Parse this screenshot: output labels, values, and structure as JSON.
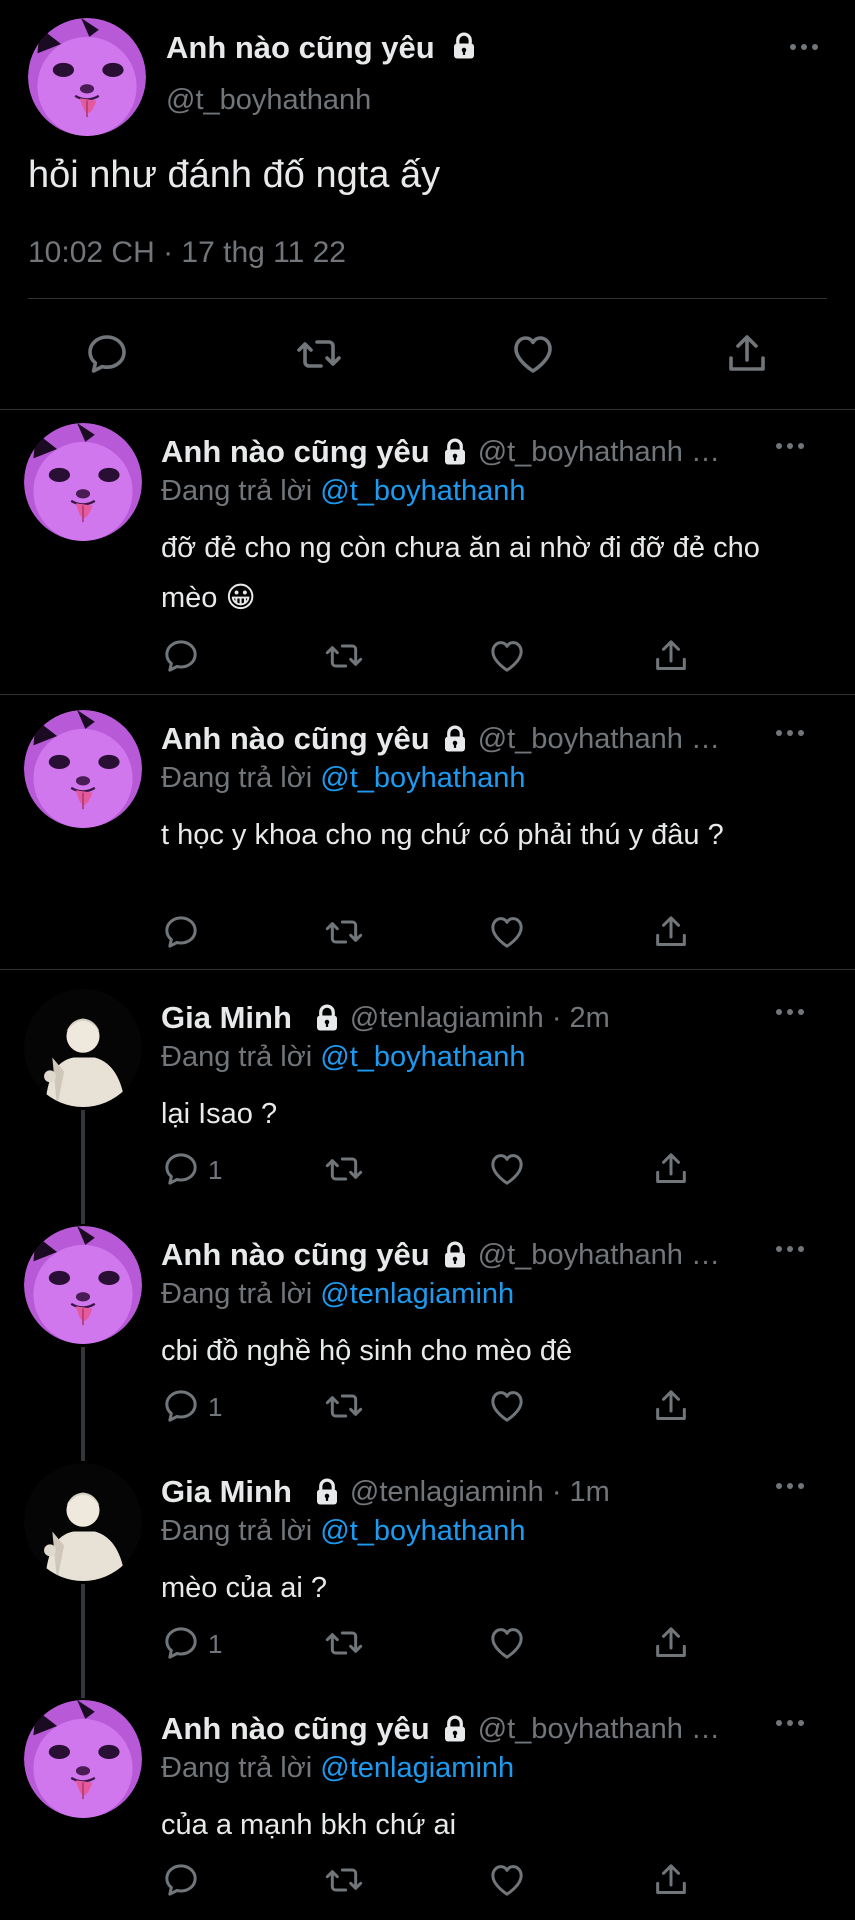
{
  "main_tweet": {
    "author_name": "Anh nào cũng yêu",
    "handle": "@t_boyhathanh",
    "text": "hỏi như đánh đố ngta ấy",
    "timestamp": "10:02 CH · 17 thg 11 22"
  },
  "replying_label": "Đang trả lời",
  "replies": [
    {
      "author_name": "Anh nào cũng yêu",
      "handle_time": "@t_boyhathanh …",
      "replying_to": "@t_boyhathanh",
      "text": "đỡ đẻ cho ng còn chưa ăn ai nhờ đi đỡ đẻ cho mèo 😀",
      "reply_count": ""
    },
    {
      "author_name": "Anh nào cũng yêu",
      "handle_time": "@t_boyhathanh …",
      "replying_to": "@t_boyhathanh",
      "text": "t học y khoa cho ng chứ có phải thú y đâu ?",
      "reply_count": ""
    },
    {
      "author_name": "Gia Minh",
      "handle_time": "@tenlagiaminh · 2m",
      "replying_to": "@t_boyhathanh",
      "text": "lại Isao ?",
      "reply_count": "1"
    },
    {
      "author_name": "Anh nào cũng yêu",
      "handle_time": "@t_boyhathanh …",
      "replying_to": "@tenlagiaminh",
      "text": "cbi đồ nghề hộ sinh cho mèo đê",
      "reply_count": "1"
    },
    {
      "author_name": "Gia Minh",
      "handle_time": "@tenlagiaminh · 1m",
      "replying_to": "@t_boyhathanh",
      "text": "mèo của ai ?",
      "reply_count": "1"
    },
    {
      "author_name": "Anh nào cũng yêu",
      "handle_time": "@t_boyhathanh …",
      "replying_to": "@tenlagiaminh",
      "text": "của a mạnh bkh chứ ai",
      "reply_count": ""
    }
  ],
  "icons": {
    "reply": "reply-icon",
    "retweet": "retweet-icon",
    "like": "heart-icon",
    "share": "share-icon",
    "lock": "lock-icon",
    "more": "more-icon"
  },
  "colors": {
    "background": "#000000",
    "text": "#e7e9ea",
    "secondary": "#71767b",
    "link": "#1d9bf0",
    "divider": "#2f3336",
    "cat_avatar": "#c061e0"
  }
}
